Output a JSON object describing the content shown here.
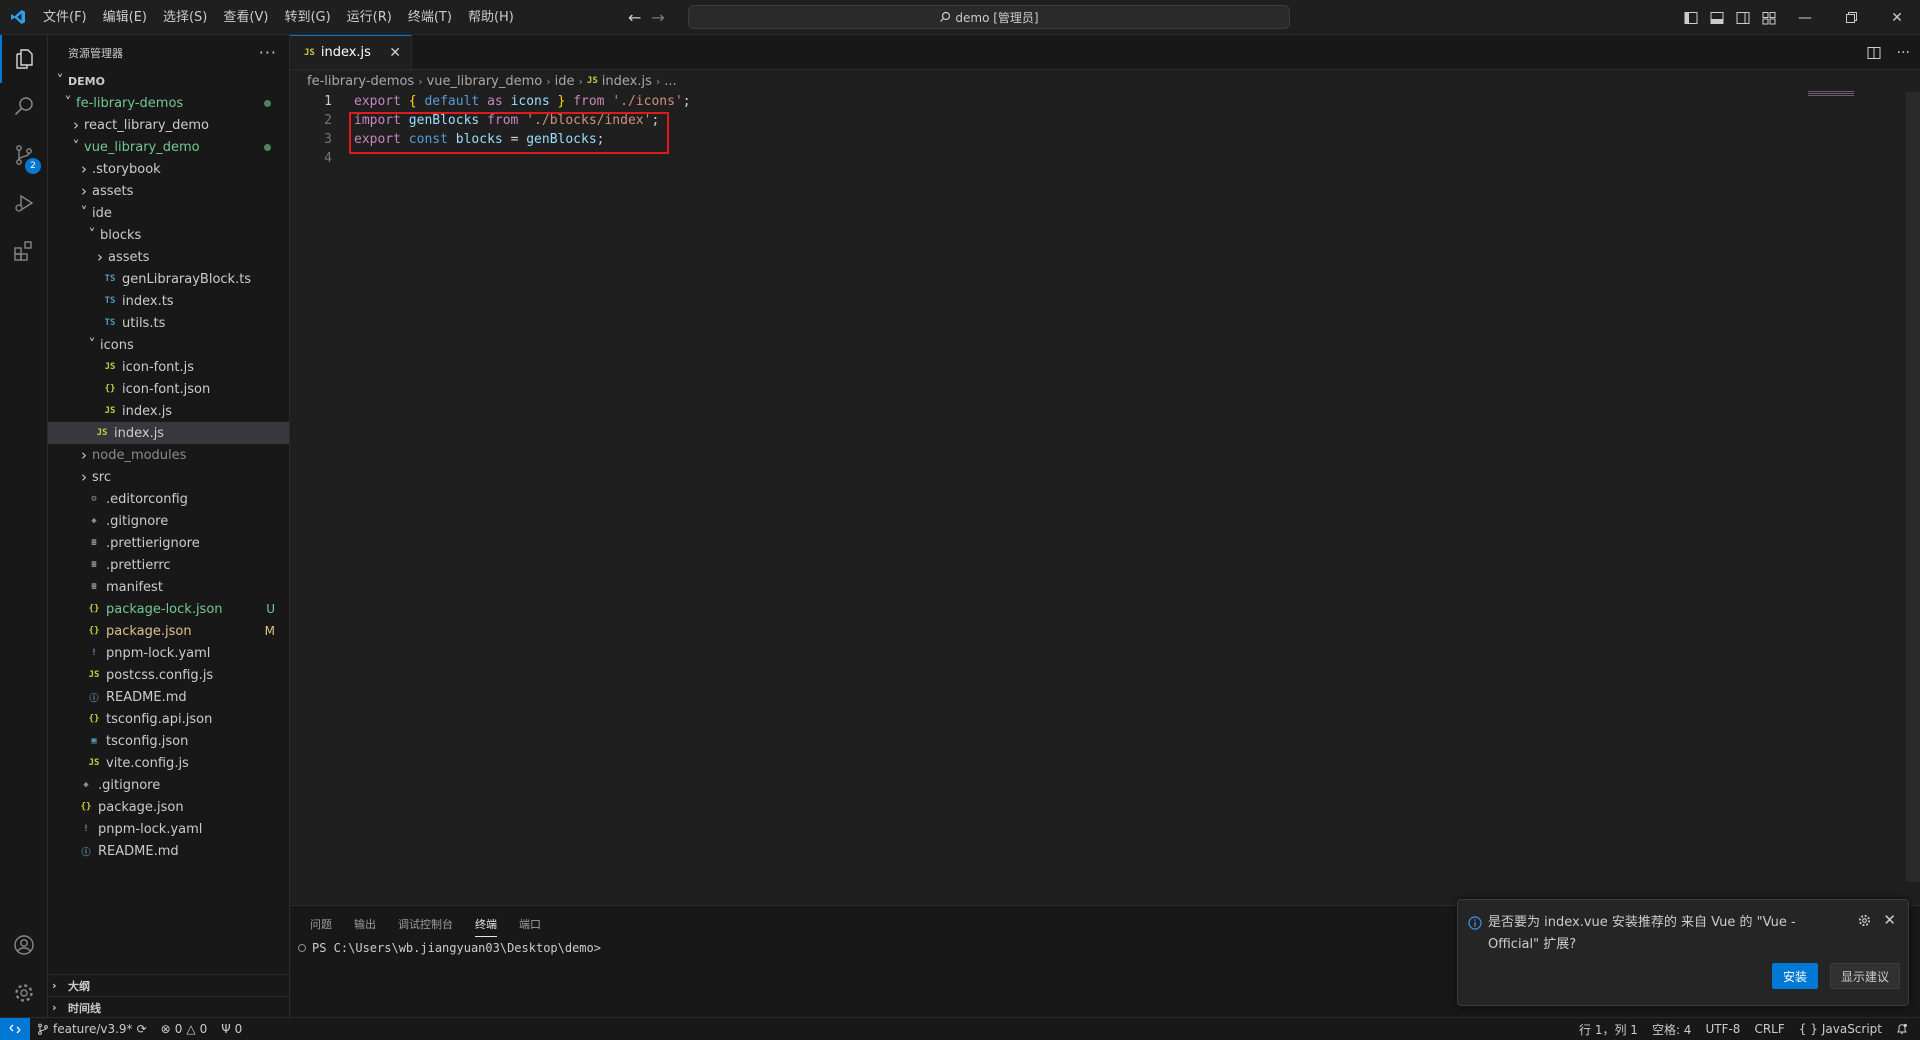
{
  "titlebar": {
    "menus": [
      "文件(F)",
      "编辑(E)",
      "选择(S)",
      "查看(V)",
      "转到(G)",
      "运行(R)",
      "终端(T)",
      "帮助(H)"
    ],
    "search_text": "demo [管理员]"
  },
  "activitybar": {
    "items": [
      "explorer-icon",
      "search-icon",
      "source-control-icon",
      "run-debug-icon",
      "extensions-icon"
    ],
    "scm_badge": "2",
    "bottom": [
      "account-icon",
      "manage-gear-icon"
    ]
  },
  "sidebar": {
    "title": "资源管理器",
    "more": "···",
    "tree": [
      {
        "label": "DEMO",
        "depth": 0,
        "type": "root",
        "open": true
      },
      {
        "label": "fe-library-demos",
        "depth": 1,
        "type": "folder",
        "open": true,
        "color": "green",
        "dot": true
      },
      {
        "label": "react_library_demo",
        "depth": 2,
        "type": "folder",
        "open": false
      },
      {
        "label": "vue_library_demo",
        "depth": 2,
        "type": "folder",
        "open": true,
        "color": "green",
        "dot": true
      },
      {
        "label": ".storybook",
        "depth": 3,
        "type": "folder",
        "open": false
      },
      {
        "label": "assets",
        "depth": 3,
        "type": "folder",
        "open": false
      },
      {
        "label": "ide",
        "depth": 3,
        "type": "folder",
        "open": true
      },
      {
        "label": "blocks",
        "depth": 4,
        "type": "folder",
        "open": true
      },
      {
        "label": "assets",
        "depth": 5,
        "type": "folder",
        "open": false
      },
      {
        "label": "genLibrarayBlock.ts",
        "depth": 5,
        "type": "ts"
      },
      {
        "label": "index.ts",
        "depth": 5,
        "type": "ts"
      },
      {
        "label": "utils.ts",
        "depth": 5,
        "type": "ts"
      },
      {
        "label": "icons",
        "depth": 4,
        "type": "folder",
        "open": true
      },
      {
        "label": "icon-font.js",
        "depth": 5,
        "type": "js"
      },
      {
        "label": "icon-font.json",
        "depth": 5,
        "type": "json"
      },
      {
        "label": "index.js",
        "depth": 5,
        "type": "js"
      },
      {
        "label": "index.js",
        "depth": 4,
        "type": "js",
        "selected": true
      },
      {
        "label": "node_modules",
        "depth": 3,
        "type": "folder",
        "open": false,
        "color": "grey"
      },
      {
        "label": "src",
        "depth": 3,
        "type": "folder",
        "open": false
      },
      {
        "label": ".editorconfig",
        "depth": 3,
        "type": "gear"
      },
      {
        "label": ".gitignore",
        "depth": 3,
        "type": "diamond"
      },
      {
        "label": ".prettierignore",
        "depth": 3,
        "type": "lines"
      },
      {
        "label": ".prettierrc",
        "depth": 3,
        "type": "lines"
      },
      {
        "label": "manifest",
        "depth": 3,
        "type": "lines"
      },
      {
        "label": "package-lock.json",
        "depth": 3,
        "type": "json",
        "color": "green",
        "status": "U"
      },
      {
        "label": "package.json",
        "depth": 3,
        "type": "json",
        "color": "orange",
        "status": "M"
      },
      {
        "label": "pnpm-lock.yaml",
        "depth": 3,
        "type": "yaml"
      },
      {
        "label": "postcss.config.js",
        "depth": 3,
        "type": "js"
      },
      {
        "label": "README.md",
        "depth": 3,
        "type": "info"
      },
      {
        "label": "tsconfig.api.json",
        "depth": 3,
        "type": "json"
      },
      {
        "label": "tsconfig.json",
        "depth": 3,
        "type": "tsconfig"
      },
      {
        "label": "vite.config.js",
        "depth": 3,
        "type": "js"
      },
      {
        "label": ".gitignore",
        "depth": 2,
        "type": "diamond"
      },
      {
        "label": "package.json",
        "depth": 2,
        "type": "json"
      },
      {
        "label": "pnpm-lock.yaml",
        "depth": 2,
        "type": "yaml"
      },
      {
        "label": "README.md",
        "depth": 2,
        "type": "info"
      }
    ],
    "outline_label": "大纲",
    "timeline_label": "时间线"
  },
  "editor": {
    "tab_label": "index.js",
    "tab_icon": "JS",
    "breadcrumbs": [
      "fe-library-demos",
      "vue_library_demo",
      "ide",
      "index.js",
      "..."
    ],
    "lines": [
      {
        "n": "1",
        "tokens": [
          [
            "kw",
            "export "
          ],
          [
            "brace",
            "{ "
          ],
          [
            "kw2",
            "default "
          ],
          [
            "kw",
            "as "
          ],
          [
            "id",
            "icons "
          ],
          [
            "brace",
            "} "
          ],
          [
            "kw",
            "from "
          ],
          [
            "str",
            "'./icons'"
          ],
          [
            "pun",
            ";"
          ]
        ]
      },
      {
        "n": "2",
        "tokens": [
          [
            "kw",
            "import "
          ],
          [
            "id",
            "genBlocks "
          ],
          [
            "kw",
            "from "
          ],
          [
            "str",
            "'./blocks/index'"
          ],
          [
            "pun",
            ";"
          ]
        ]
      },
      {
        "n": "3",
        "tokens": [
          [
            "kw",
            "export "
          ],
          [
            "kw2",
            "const "
          ],
          [
            "id",
            "blocks "
          ],
          [
            "pun",
            "= "
          ],
          [
            "id",
            "genBlocks"
          ],
          [
            "pun",
            ";"
          ]
        ]
      },
      {
        "n": "4",
        "tokens": []
      }
    ]
  },
  "panel": {
    "tabs": [
      "问题",
      "输出",
      "调试控制台",
      "终端",
      "端口"
    ],
    "active_tab": "终端",
    "terminal_line": "PS C:\\Users\\wb.jiangyuan03\\Desktop\\demo>"
  },
  "notification": {
    "message": "是否要为 index.vue 安装推荐的 来自 Vue 的 \"Vue - Official\" 扩展?",
    "install_label": "安装",
    "show_label": "显示建议"
  },
  "statusbar": {
    "branch": "feature/v3.9*",
    "errors": "0",
    "warnings": "0",
    "ports": "0",
    "position": "行 1，列 1",
    "spaces": "空格: 4",
    "encoding": "UTF-8",
    "eol": "CRLF",
    "language": "JavaScript"
  },
  "colors": {
    "accent": "#0078d4",
    "highlight_box": "#e01b1b",
    "git_added": "#73c991",
    "git_modified": "#e2c08d"
  }
}
